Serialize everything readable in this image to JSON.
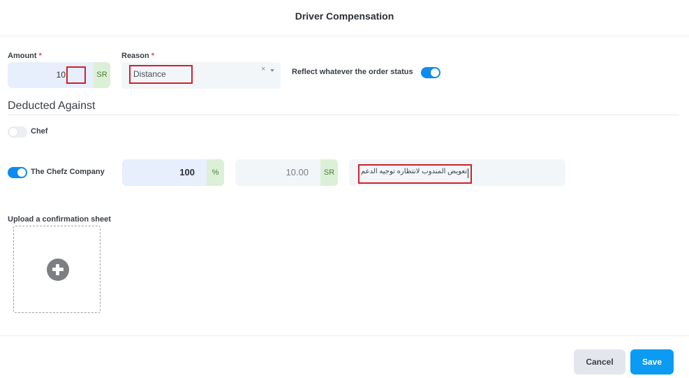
{
  "dialog": {
    "title": "Driver Compensation"
  },
  "form": {
    "amount": {
      "label": "Amount",
      "required_mark": "*",
      "value": "10",
      "currency": "SR"
    },
    "reason": {
      "label": "Reason",
      "required_mark": "*",
      "value": "Distance",
      "clear_symbol": "×"
    },
    "reflect": {
      "label": "Reflect whatever the order status",
      "checked": true
    }
  },
  "deducted_against": {
    "title": "Deducted Against",
    "options": [
      {
        "label": "Chef",
        "checked": false
      },
      {
        "label": "The Chefz Company",
        "checked": true,
        "percent_value": "100",
        "percent_symbol": "%",
        "amount_value": "10.00",
        "amount_currency": "SR",
        "note": "تعويض المندوب لانتظاره توجيه الدعم"
      }
    ]
  },
  "upload": {
    "label": "Upload a confirmation sheet",
    "icon": "plus-circle-icon"
  },
  "footer": {
    "cancel_label": "Cancel",
    "save_label": "Save"
  },
  "colors": {
    "accent": "#0b9bf2",
    "addon_green": "#dbf0d6",
    "input_blue": "#e7eefc",
    "highlight_red": "#d2202a"
  }
}
